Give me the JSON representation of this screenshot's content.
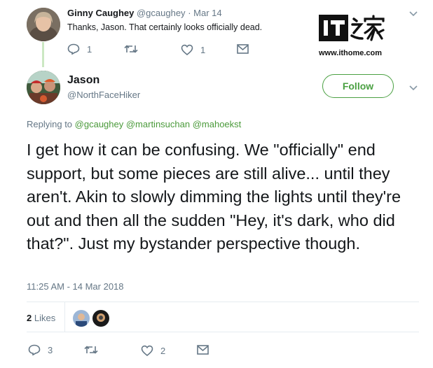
{
  "watermark": {
    "logo_text": "IT之家",
    "url": "www.ithome.com"
  },
  "reply_tweet": {
    "name": "Ginny Caughey",
    "handle": "@gcaughey",
    "separator": "·",
    "date": "Mar 14",
    "text": "Thanks, Jason. That certainly looks officially dead.",
    "actions": {
      "replies": "1",
      "retweets": "",
      "likes": "1"
    }
  },
  "main_tweet": {
    "name": "Jason",
    "handle": "@NorthFaceHiker",
    "follow_label": "Follow",
    "replying_prefix": "Replying to",
    "replying_to": "@gcaughey @martinsuchan @mahoekst",
    "text": "I get how it can be confusing.  We \"officially\" end support, but some pieces are still alive... until they aren't.  Akin to slowly dimming the lights until they're out and then all the sudden \"Hey, it's dark, who did that?\".  Just my bystander perspective though.",
    "timestamp": "11:25 AM - 14 Mar 2018",
    "likes_count": "2",
    "likes_label": "Likes",
    "actions": {
      "replies": "3",
      "retweets": "",
      "likes": "2"
    }
  },
  "colors": {
    "accent": "#4aa042",
    "muted": "#657786",
    "thread_line": "#cce8c3"
  },
  "icons": [
    "reply-icon",
    "retweet-icon",
    "like-icon",
    "direct-message-icon",
    "chevron-down-icon"
  ]
}
